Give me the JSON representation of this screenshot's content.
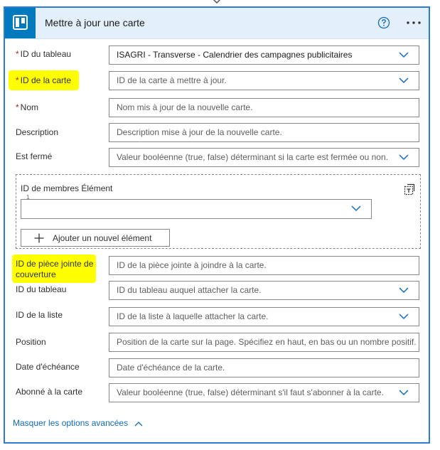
{
  "header": {
    "title": "Mettre à jour une carte",
    "logo_icon": "trello-icon",
    "help_icon": "help-circle-icon",
    "menu_icon": "more-horizontal-icon"
  },
  "fields": [
    {
      "id": "board-id",
      "label": "ID du tableau",
      "required": true,
      "value": "ISAGRI - Transverse - Calendrier des campagnes publicitaires",
      "placeholder": "",
      "dropdown": true
    },
    {
      "id": "card-id",
      "label": "ID de la carte",
      "required": true,
      "value": "",
      "placeholder": "ID de la carte à mettre à jour.",
      "dropdown": true,
      "highlighted": true
    },
    {
      "id": "name",
      "label": "Nom",
      "required": true,
      "value": "",
      "placeholder": "Nom mis à jour de la nouvelle carte.",
      "dropdown": false
    },
    {
      "id": "description",
      "label": "Description",
      "required": false,
      "value": "",
      "placeholder": "Description mise à jour de la nouvelle carte.",
      "dropdown": false
    },
    {
      "id": "closed",
      "label": "Est fermé",
      "required": false,
      "value": "",
      "placeholder": "Valeur booléenne (true, false) déterminant si la carte est fermée ou non.",
      "dropdown": true
    }
  ],
  "members": {
    "label": "ID de membres Élément",
    "index": "1",
    "add_button": "Ajouter un nouvel élément"
  },
  "fields2": [
    {
      "id": "cover-attachment",
      "label": "ID de pièce jointe de couverture",
      "required": false,
      "value": "",
      "placeholder": "ID de la pièce jointe à joindre à la carte.",
      "dropdown": false,
      "highlighted": true
    },
    {
      "id": "board-id-2",
      "label": "ID du tableau",
      "required": false,
      "value": "",
      "placeholder": "ID du tableau auquel attacher la carte.",
      "dropdown": true
    },
    {
      "id": "list-id",
      "label": "ID de la liste",
      "required": false,
      "value": "",
      "placeholder": "ID de la liste à laquelle attacher la carte.",
      "dropdown": true
    },
    {
      "id": "position",
      "label": "Position",
      "required": false,
      "value": "",
      "placeholder": "Position de la carte sur la page. Spécifiez en haut, en bas ou un nombre positif.",
      "dropdown": false
    },
    {
      "id": "due-date",
      "label": "Date d'échéance",
      "required": false,
      "value": "",
      "placeholder": "Date d'échéance de la carte.",
      "dropdown": false
    },
    {
      "id": "subscribed",
      "label": "Abonné à la carte",
      "required": false,
      "value": "",
      "placeholder": "Valeur booléenne (true, false) déterminant s'il faut s'abonner à la carte.",
      "dropdown": true
    }
  ],
  "advanced_link": "Masquer les options avancées",
  "colors": {
    "accent": "#2b7cd3",
    "header_bg": "#e3f0fb",
    "trello": "#0079bf",
    "highlight": "#ffff00",
    "required": "#a4262c"
  }
}
